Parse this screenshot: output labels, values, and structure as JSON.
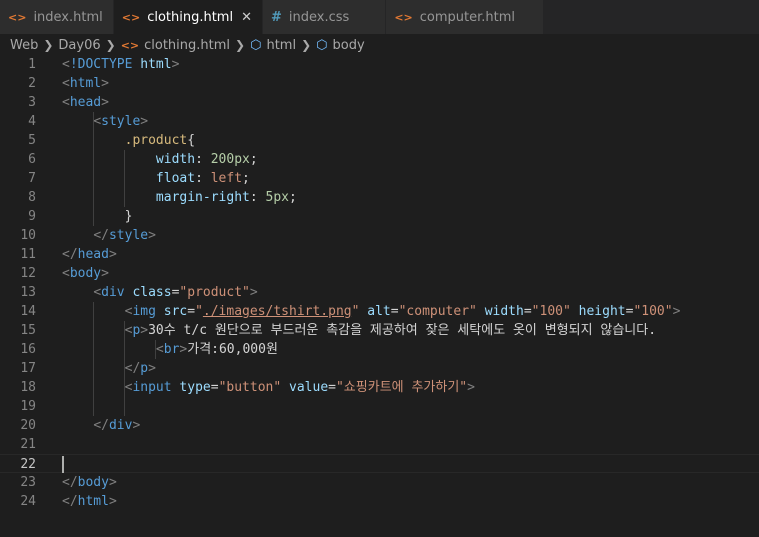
{
  "tabs": [
    {
      "label": "index.html",
      "icon": "html-file-icon",
      "active": false
    },
    {
      "label": "clothing.html",
      "icon": "html-file-icon",
      "active": true
    },
    {
      "label": "index.css",
      "icon": "css-file-icon",
      "active": false
    },
    {
      "label": "computer.html",
      "icon": "html-file-icon",
      "active": false
    }
  ],
  "breadcrumb": [
    "Web",
    "Day06",
    "clothing.html",
    "html",
    "body"
  ],
  "editor": {
    "current_line": 22,
    "lines": [
      {
        "n": "1",
        "tokens": [
          [
            "punc",
            "<"
          ],
          [
            "tag",
            "!DOCTYPE "
          ],
          [
            "attr",
            "html"
          ],
          [
            "punc",
            ">"
          ]
        ]
      },
      {
        "n": "2",
        "tokens": [
          [
            "punc",
            "<"
          ],
          [
            "tag",
            "html"
          ],
          [
            "punc",
            ">"
          ]
        ]
      },
      {
        "n": "3",
        "tokens": [
          [
            "punc",
            "<"
          ],
          [
            "tag",
            "head"
          ],
          [
            "punc",
            ">"
          ]
        ]
      },
      {
        "n": "4",
        "tokens": [
          [
            "txt",
            "    "
          ],
          [
            "punc",
            "<"
          ],
          [
            "tag",
            "style"
          ],
          [
            "punc",
            ">"
          ]
        ]
      },
      {
        "n": "5",
        "tokens": [
          [
            "txt",
            "        "
          ],
          [
            "sel",
            ".product"
          ],
          [
            "txt",
            "{"
          ]
        ]
      },
      {
        "n": "6",
        "tokens": [
          [
            "txt",
            "            "
          ],
          [
            "prop",
            "width"
          ],
          [
            "txt",
            ": "
          ],
          [
            "num",
            "200px"
          ],
          [
            "txt",
            ";"
          ]
        ]
      },
      {
        "n": "7",
        "tokens": [
          [
            "txt",
            "            "
          ],
          [
            "prop",
            "float"
          ],
          [
            "txt",
            ": "
          ],
          [
            "str",
            "left"
          ],
          [
            "txt",
            ";"
          ]
        ]
      },
      {
        "n": "8",
        "tokens": [
          [
            "txt",
            "            "
          ],
          [
            "prop",
            "margin-right"
          ],
          [
            "txt",
            ": "
          ],
          [
            "num",
            "5px"
          ],
          [
            "txt",
            ";"
          ]
        ]
      },
      {
        "n": "9",
        "tokens": [
          [
            "txt",
            "        "
          ],
          [
            "txt",
            "}"
          ]
        ]
      },
      {
        "n": "10",
        "tokens": [
          [
            "txt",
            "    "
          ],
          [
            "punc",
            "</"
          ],
          [
            "tag",
            "style"
          ],
          [
            "punc",
            ">"
          ]
        ]
      },
      {
        "n": "11",
        "tokens": [
          [
            "punc",
            "</"
          ],
          [
            "tag",
            "head"
          ],
          [
            "punc",
            ">"
          ]
        ]
      },
      {
        "n": "12",
        "tokens": [
          [
            "punc",
            "<"
          ],
          [
            "tag",
            "body"
          ],
          [
            "punc",
            ">"
          ]
        ]
      },
      {
        "n": "13",
        "tokens": [
          [
            "txt",
            "    "
          ],
          [
            "punc",
            "<"
          ],
          [
            "tag",
            "div "
          ],
          [
            "attr",
            "class"
          ],
          [
            "txt",
            "="
          ],
          [
            "str",
            "\"product\""
          ],
          [
            "punc",
            ">"
          ]
        ]
      },
      {
        "n": "14",
        "tokens": [
          [
            "txt",
            "        "
          ],
          [
            "punc",
            "<"
          ],
          [
            "tag",
            "img "
          ],
          [
            "attr",
            "src"
          ],
          [
            "txt",
            "="
          ],
          [
            "str",
            "\""
          ],
          [
            "link",
            "./images/tshirt.png"
          ],
          [
            "str",
            "\""
          ],
          [
            "txt",
            " "
          ],
          [
            "attr",
            "alt"
          ],
          [
            "txt",
            "="
          ],
          [
            "str",
            "\"computer\""
          ],
          [
            "txt",
            " "
          ],
          [
            "attr",
            "width"
          ],
          [
            "txt",
            "="
          ],
          [
            "str",
            "\"100\""
          ],
          [
            "txt",
            " "
          ],
          [
            "attr",
            "height"
          ],
          [
            "txt",
            "="
          ],
          [
            "str",
            "\"100\""
          ],
          [
            "punc",
            ">"
          ]
        ]
      },
      {
        "n": "15",
        "tokens": [
          [
            "txt",
            "        "
          ],
          [
            "punc",
            "<"
          ],
          [
            "tag",
            "p"
          ],
          [
            "punc",
            ">"
          ],
          [
            "txt",
            "30수 t/c 원단으로 부드러운 촉감을 제공하여 잦은 세탁에도 옷이 변형되지 않습니다."
          ]
        ]
      },
      {
        "n": "16",
        "tokens": [
          [
            "txt",
            "            "
          ],
          [
            "punc",
            "<"
          ],
          [
            "tag",
            "br"
          ],
          [
            "punc",
            ">"
          ],
          [
            "txt",
            "가격:60,000원"
          ]
        ]
      },
      {
        "n": "17",
        "tokens": [
          [
            "txt",
            "        "
          ],
          [
            "punc",
            "</"
          ],
          [
            "tag",
            "p"
          ],
          [
            "punc",
            ">"
          ]
        ]
      },
      {
        "n": "18",
        "tokens": [
          [
            "txt",
            "        "
          ],
          [
            "punc",
            "<"
          ],
          [
            "tag",
            "input "
          ],
          [
            "attr",
            "type"
          ],
          [
            "txt",
            "="
          ],
          [
            "str",
            "\"button\""
          ],
          [
            "txt",
            " "
          ],
          [
            "attr",
            "value"
          ],
          [
            "txt",
            "="
          ],
          [
            "str",
            "\"쇼핑카트에 추가하기\""
          ],
          [
            "punc",
            ">"
          ]
        ]
      },
      {
        "n": "19",
        "tokens": []
      },
      {
        "n": "20",
        "tokens": [
          [
            "txt",
            "    "
          ],
          [
            "punc",
            "</"
          ],
          [
            "tag",
            "div"
          ],
          [
            "punc",
            ">"
          ]
        ]
      },
      {
        "n": "21",
        "tokens": []
      },
      {
        "n": "22",
        "tokens": []
      },
      {
        "n": "23",
        "tokens": [
          [
            "punc",
            "</"
          ],
          [
            "tag",
            "body"
          ],
          [
            "punc",
            ">"
          ]
        ]
      },
      {
        "n": "24",
        "tokens": [
          [
            "punc",
            "</"
          ],
          [
            "tag",
            "html"
          ],
          [
            "punc",
            ">"
          ]
        ]
      }
    ]
  }
}
